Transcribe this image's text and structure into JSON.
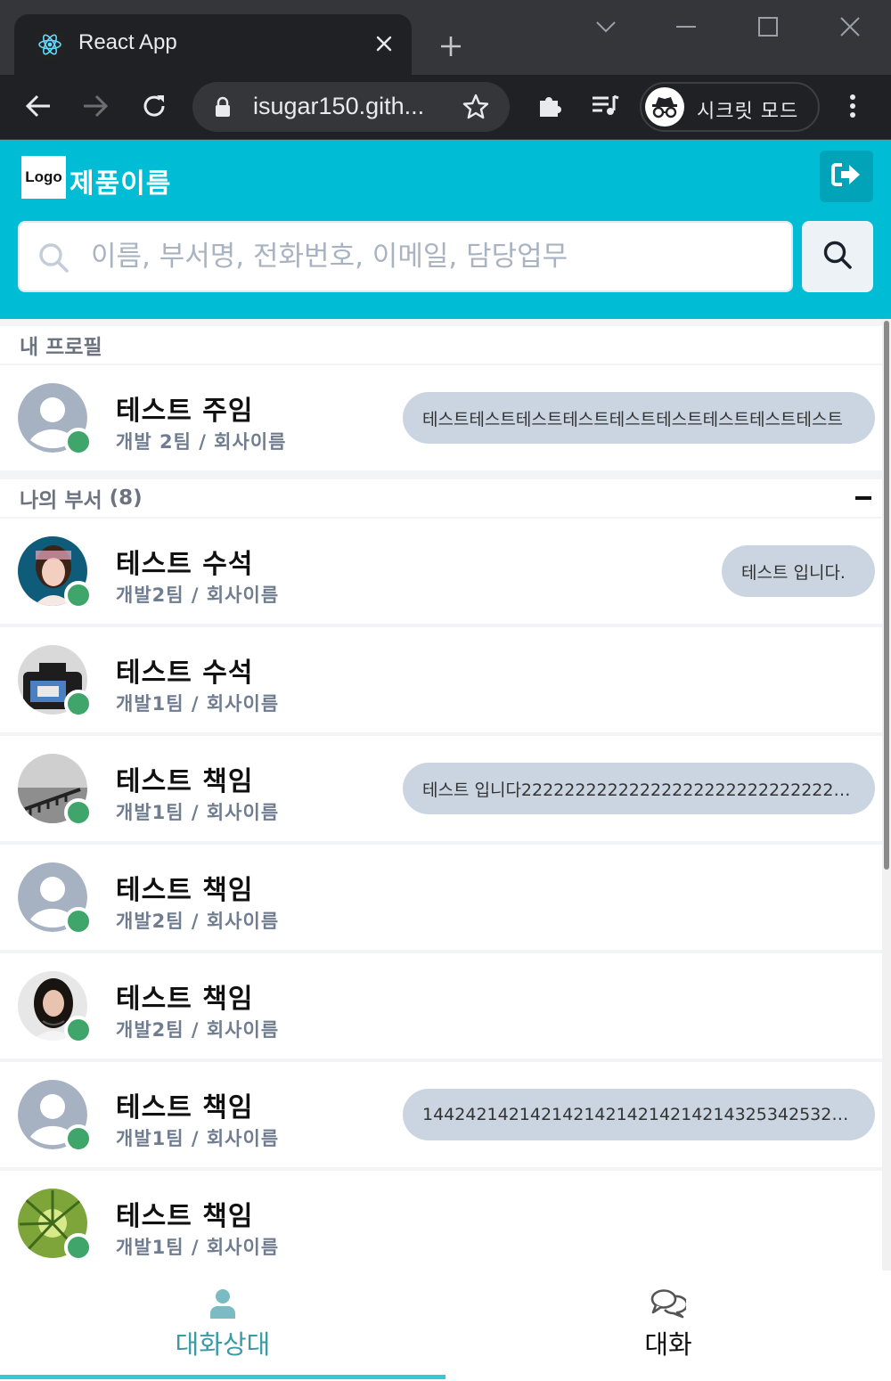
{
  "browser": {
    "tab_title": "React App",
    "url": "isugar150.gith...",
    "profile_label": "시크릿 모드"
  },
  "header": {
    "logo_text": "Logo",
    "product_name": "제품이름",
    "search_placeholder": "이름, 부서명, 전화번호, 이메일, 담당업무"
  },
  "my_profile": {
    "section_title": "내 프로필",
    "name": "테스트 주임",
    "dept": "개발 2팀 / 회사이름",
    "status_message": "테스트테스트테스트테스트테스트테스트테스트테스트테스트"
  },
  "my_department": {
    "section_title": "나의 부서",
    "count": "(8)",
    "members": [
      {
        "name": "테스트 수석",
        "dept": "개발2팀 / 회사이름",
        "status_message": "테스트 입니다.",
        "avatar": "photo-portrait-1"
      },
      {
        "name": "테스트 수석",
        "dept": "개발1팀 / 회사이름",
        "status_message": "",
        "avatar": "photo-camera"
      },
      {
        "name": "테스트 책임",
        "dept": "개발1팀 / 회사이름",
        "status_message": "테스트 입니다2222222222222222222222222222222222",
        "avatar": "photo-pier"
      },
      {
        "name": "테스트 책임",
        "dept": "개발2팀 / 회사이름",
        "status_message": "",
        "avatar": "default-user"
      },
      {
        "name": "테스트 책임",
        "dept": "개발2팀 / 회사이름",
        "status_message": "",
        "avatar": "photo-portrait-2"
      },
      {
        "name": "테스트 책임",
        "dept": "개발1팀 / 회사이름",
        "status_message": "144242142142142142142142142143253425329804732832",
        "avatar": "default-user"
      },
      {
        "name": "테스트 책임",
        "dept": "개발1팀 / 회사이름",
        "status_message": "",
        "avatar": "photo-leaves"
      }
    ]
  },
  "bottom_nav": {
    "contacts_label": "대화상대",
    "chat_label": "대화"
  },
  "colors": {
    "brand": "#00bcd4",
    "online": "#3fa56b",
    "bubble": "#cbd5e1",
    "active_tab": "#38c6d9"
  }
}
